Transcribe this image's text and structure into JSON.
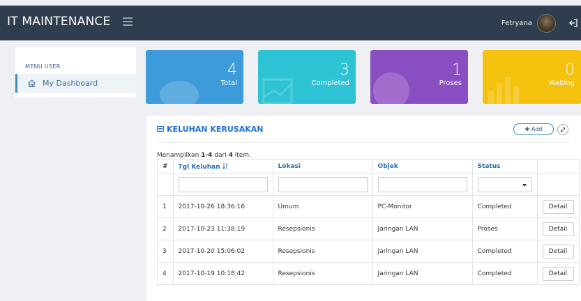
{
  "app": {
    "title": "IT MAINTENANCE",
    "user_name": "Fetryana"
  },
  "sidebar": {
    "heading": "MENU USER",
    "items": [
      {
        "label": "My Dashboard",
        "icon": "home-icon"
      }
    ]
  },
  "stats": [
    {
      "value": "4",
      "label": "Total",
      "color": "#3e9bd9"
    },
    {
      "value": "3",
      "label": "Completed",
      "color": "#2ec3d4"
    },
    {
      "value": "1",
      "label": "Proses",
      "color": "#8b4ec2"
    },
    {
      "value": "0",
      "label": "Waiting",
      "color": "#f4c20d"
    }
  ],
  "panel": {
    "title": "KELUHAN KERUSAKAN",
    "add_label": "Add",
    "summary": {
      "prefix": "Menampilkan ",
      "range": "1-4",
      "middle": " dari ",
      "total": "4",
      "suffix": " item."
    },
    "columns": [
      "#",
      "Tgl Keluhan",
      "Lokasi",
      "Objek",
      "Status"
    ],
    "rows": [
      {
        "no": "1",
        "tgl": "2017-10-26 18:36:16",
        "lokasi": "Umum",
        "objek": "PC-Monitor",
        "status": "Completed",
        "action": "Detail"
      },
      {
        "no": "2",
        "tgl": "2017-10-23 11:38:19",
        "lokasi": "Resepsionis",
        "objek": "Jaringan LAN",
        "status": "Proses",
        "action": "Detail"
      },
      {
        "no": "3",
        "tgl": "2017-10-20 15:06:02",
        "lokasi": "Resepsionis",
        "objek": "Jaringan LAN",
        "status": "Completed",
        "action": "Detail"
      },
      {
        "no": "4",
        "tgl": "2017-10-19 10:18:42",
        "lokasi": "Resepsionis",
        "objek": "Jaringan LAN",
        "status": "Completed",
        "action": "Detail"
      }
    ]
  }
}
